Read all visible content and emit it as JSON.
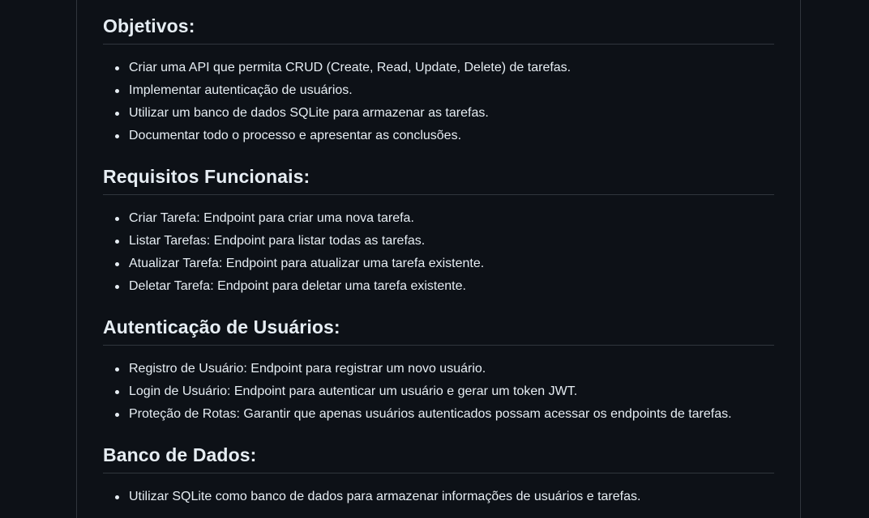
{
  "readme": {
    "sections": [
      {
        "heading": "Objetivos:",
        "items": [
          "Criar uma API que permita CRUD (Create, Read, Update, Delete) de tarefas.",
          "Implementar autenticação de usuários.",
          "Utilizar um banco de dados SQLite para armazenar as tarefas.",
          "Documentar todo o processo e apresentar as conclusões."
        ]
      },
      {
        "heading": "Requisitos Funcionais:",
        "items": [
          "Criar Tarefa: Endpoint para criar uma nova tarefa.",
          "Listar Tarefas: Endpoint para listar todas as tarefas.",
          "Atualizar Tarefa: Endpoint para atualizar uma tarefa existente.",
          "Deletar Tarefa: Endpoint para deletar uma tarefa existente."
        ]
      },
      {
        "heading": "Autenticação de Usuários:",
        "items": [
          "Registro de Usuário: Endpoint para registrar um novo usuário.",
          "Login de Usuário: Endpoint para autenticar um usuário e gerar um token JWT.",
          "Proteção de Rotas: Garantir que apenas usuários autenticados possam acessar os endpoints de tarefas."
        ]
      },
      {
        "heading": "Banco de Dados:",
        "items": [
          "Utilizar SQLite como banco de dados para armazenar informações de usuários e tarefas."
        ]
      }
    ]
  },
  "colors": {
    "background": "#0d1117",
    "text": "#e6edf3",
    "border": "#30363d"
  }
}
